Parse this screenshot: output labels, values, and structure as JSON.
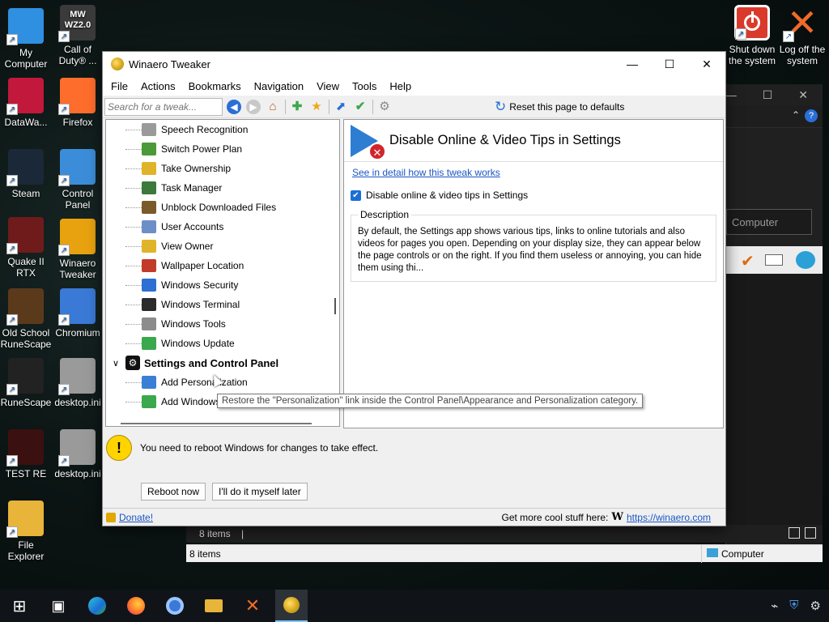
{
  "desktop": {
    "icons_left": [
      {
        "label": "My Computer",
        "color": "#2f8fe0"
      },
      {
        "label": "DataWa...",
        "color": "#c2183c"
      },
      {
        "label": "Steam",
        "color": "#1b2838"
      },
      {
        "label": "Quake II RTX",
        "color": "#6f1b1b"
      },
      {
        "label": "Old School RuneScape",
        "color": "#5b3a1c"
      },
      {
        "label": "RuneScape",
        "color": "#222222"
      },
      {
        "label": "TEST RE",
        "color": "#3b1010"
      },
      {
        "label": "File Explorer",
        "color": "#e8b43a"
      }
    ],
    "icons_right": [
      {
        "label": "Call of Duty® ...",
        "color": "#3a3a3a",
        "badge": "MW WZ2.0"
      },
      {
        "label": "Firefox",
        "color": "#ff6d2c"
      },
      {
        "label": "Control Panel",
        "color": "#3c8dd9"
      },
      {
        "label": "Winaero Tweaker",
        "color": "#e8a20f"
      },
      {
        "label": "Chromium",
        "color": "#3a79d6"
      },
      {
        "label": "desktop.ini",
        "color": "#9a9a9a"
      },
      {
        "label": "desktop.ini",
        "color": "#9a9a9a"
      }
    ],
    "top_right": [
      {
        "label": "Shut down the system",
        "color": "#d93a2b"
      },
      {
        "label": "Log off the system",
        "color": "#f06a2a"
      }
    ]
  },
  "bg_explorer": {
    "field_text": "Computer",
    "items_count": "8 items",
    "status_count": "8 items",
    "status_computer": "Computer"
  },
  "window": {
    "title": "Winaero Tweaker",
    "menu": [
      "File",
      "Actions",
      "Bookmarks",
      "Navigation",
      "View",
      "Tools",
      "Help"
    ],
    "search_placeholder": "Search for a tweak...",
    "reset_label": "Reset this page to defaults"
  },
  "tree": {
    "items": [
      {
        "label": "Speech Recognition",
        "color": "#9a9a9a"
      },
      {
        "label": "Switch Power Plan",
        "color": "#4a9a3a"
      },
      {
        "label": "Take Ownership",
        "color": "#e0b42a"
      },
      {
        "label": "Task Manager",
        "color": "#3c7a3c"
      },
      {
        "label": "Unblock Downloaded Files",
        "color": "#7a5a2a"
      },
      {
        "label": "User Accounts",
        "color": "#6c8fc7"
      },
      {
        "label": "View Owner",
        "color": "#e0b42a"
      },
      {
        "label": "Wallpaper Location",
        "color": "#c23a2a"
      },
      {
        "label": "Windows Security",
        "color": "#2d6fd2"
      },
      {
        "label": "Windows Terminal",
        "color": "#2b2b2b"
      },
      {
        "label": "Windows Tools",
        "color": "#8c8c8c"
      },
      {
        "label": "Windows Update",
        "color": "#3aa84c"
      }
    ],
    "group": "Settings and Control Panel",
    "children": [
      {
        "label": "Add Personalization",
        "color": "#3a7fd6"
      },
      {
        "label": "Add Windows",
        "color": "#3aa84c"
      }
    ],
    "tooltip": "Restore the \"Personalization\" link inside the Control Panel\\Appearance and Personalization category."
  },
  "tweak": {
    "title": "Disable Online & Video Tips in Settings",
    "detail_link": "See in detail how this tweak works",
    "checkbox_label": "Disable online & video tips in Settings",
    "checked": true,
    "description_legend": "Description",
    "description": "By default, the Settings app shows various tips, links to online tutorials and also videos for pages you open. Depending on your display size, they can appear below the page controls or on the right. If you find them useless or annoying, you can hide them using thi..."
  },
  "notice": {
    "text": "You need to reboot Windows for changes to take effect.",
    "reboot_button": "Reboot now",
    "later_button": "I'll do it myself later"
  },
  "footer": {
    "donate": "Donate!",
    "more": "Get more cool stuff here:",
    "w": "W",
    "url": "https://winaero.com"
  }
}
